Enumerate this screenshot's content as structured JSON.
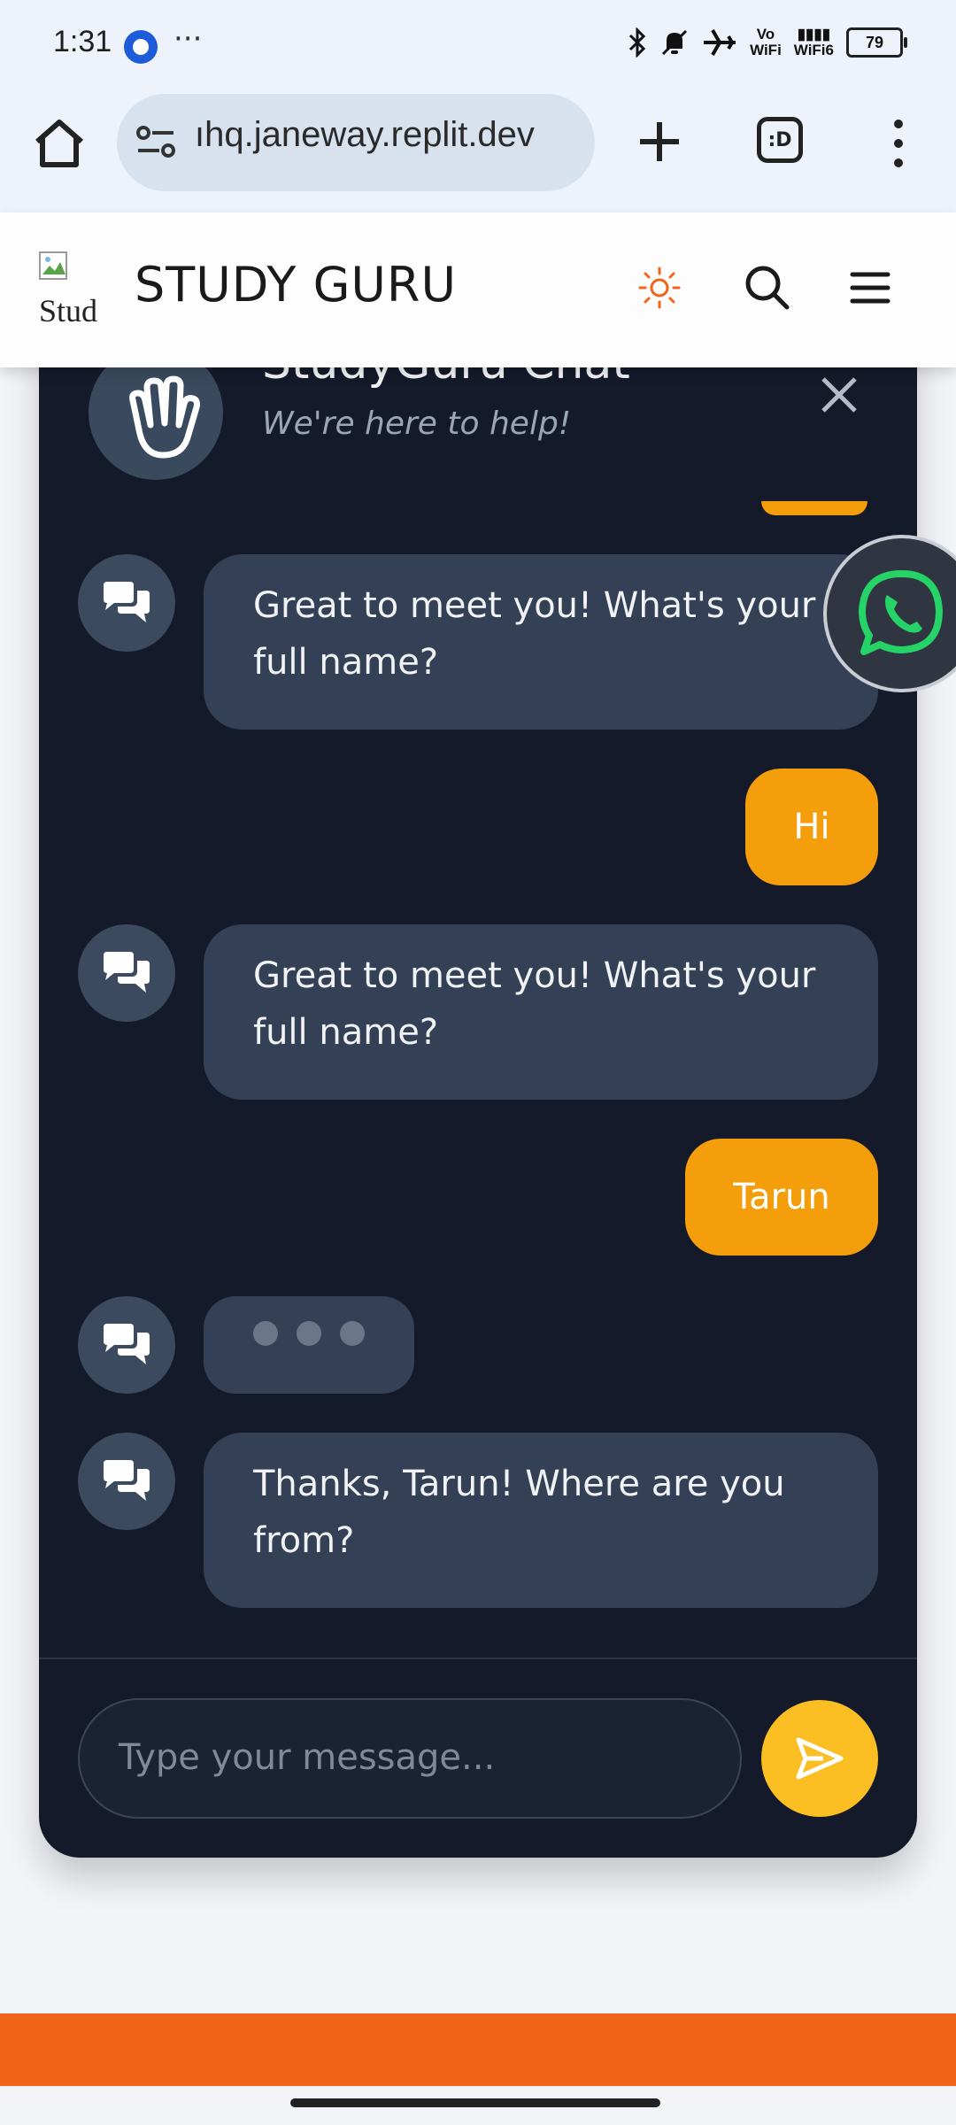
{
  "status_bar": {
    "time": "1:31",
    "more": "···",
    "volte": "Vo",
    "wifi_label": "WiFi",
    "wifi_right": "WiFi",
    "wifi_sub": "6",
    "battery": "79"
  },
  "browser": {
    "url": "ıhq.janeway.replit.dev",
    "tabs_label": ":D"
  },
  "site": {
    "logo_alt": "Stud",
    "title": "STUDY GURU"
  },
  "chat": {
    "title": "StudyGuru Chat",
    "subtitle": "We're here to help!",
    "messages": [
      {
        "from": "bot",
        "text": "Great to meet you! What's your full name?"
      },
      {
        "from": "user",
        "text": "Hi"
      },
      {
        "from": "bot",
        "text": "Great to meet you! What's your full name?"
      },
      {
        "from": "user",
        "text": "Tarun"
      },
      {
        "from": "bot",
        "typing": true
      },
      {
        "from": "bot",
        "text": "Thanks, Tarun! Where are you from?"
      }
    ],
    "input_placeholder": "Type your message..."
  },
  "colors": {
    "accent": "#f59e0b",
    "panel_bg": "#141a2a",
    "bot_bubble": "#344055",
    "footer": "#f26418",
    "sun_icon": "#f26418",
    "whatsapp": "#25d366"
  }
}
